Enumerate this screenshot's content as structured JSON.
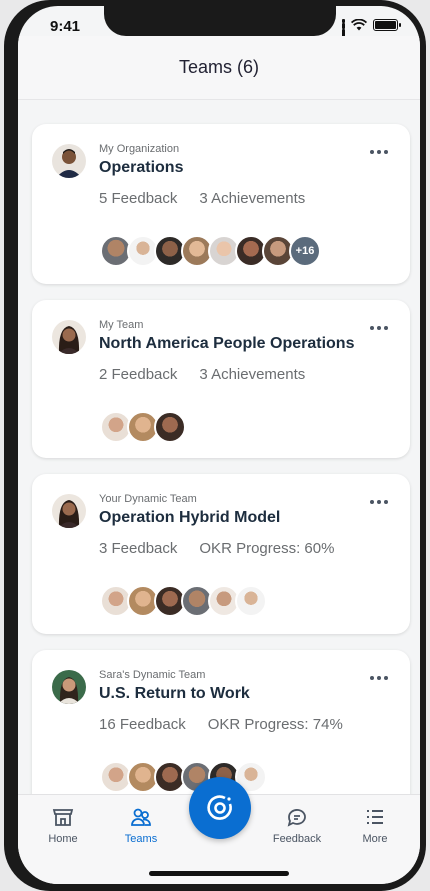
{
  "status": {
    "time": "9:41"
  },
  "header": {
    "title": "Teams (6)"
  },
  "cards": [
    {
      "kicker": "My Organization",
      "title": "Operations",
      "stat1": "5 Feedback",
      "stat2": "3 Achievements",
      "overflow": "+16"
    },
    {
      "kicker": "My Team",
      "title": "North America People Operations",
      "stat1": "2 Feedback",
      "stat2": "3 Achievements"
    },
    {
      "kicker": "Your Dynamic Team",
      "title": "Operation Hybrid Model",
      "stat1": "3 Feedback",
      "stat2": "OKR Progress: 60%"
    },
    {
      "kicker": "Sara's Dynamic Team",
      "title": "U.S. Return to Work",
      "stat1": "16 Feedback",
      "stat2": "OKR Progress: 74%"
    }
  ],
  "tabs": {
    "home": "Home",
    "teams": "Teams",
    "feedback": "Feedback",
    "more": "More"
  },
  "colors": {
    "accent": "#0a6ed1",
    "title": "#1d2d3e",
    "muted": "#6a6d70"
  }
}
